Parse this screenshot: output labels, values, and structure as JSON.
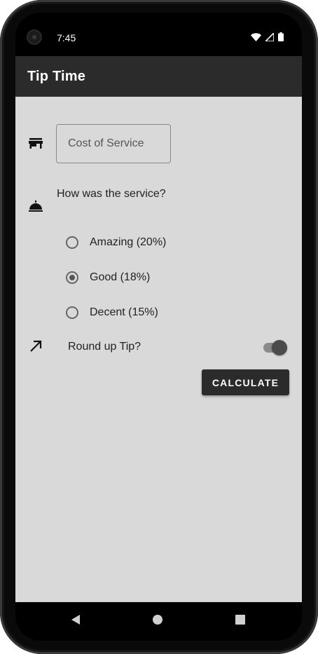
{
  "status_bar": {
    "time": "7:45",
    "icons": [
      "wifi-icon",
      "cellular-signal-icon",
      "battery-icon"
    ]
  },
  "app_bar": {
    "title": "Tip Time"
  },
  "cost_field": {
    "placeholder": "Cost of Service",
    "value": "",
    "icon": "storefront-icon"
  },
  "service_question": {
    "label": "How was the service?",
    "icon": "room-service-bell-icon"
  },
  "tip_options": [
    {
      "label": "Amazing (20%)",
      "selected": false
    },
    {
      "label": "Good (18%)",
      "selected": true
    },
    {
      "label": "Decent (15%)",
      "selected": false
    }
  ],
  "round_up": {
    "label": "Round up Tip?",
    "icon": "arrow-up-right-icon",
    "enabled": true
  },
  "calculate_button": {
    "label": "CALCULATE"
  },
  "navigation": {
    "items": [
      "back-icon",
      "home-icon",
      "recents-icon"
    ]
  },
  "colors": {
    "app_bar": "#2b2b2b",
    "background": "#d9d9d9",
    "button": "#2b2b2b"
  }
}
